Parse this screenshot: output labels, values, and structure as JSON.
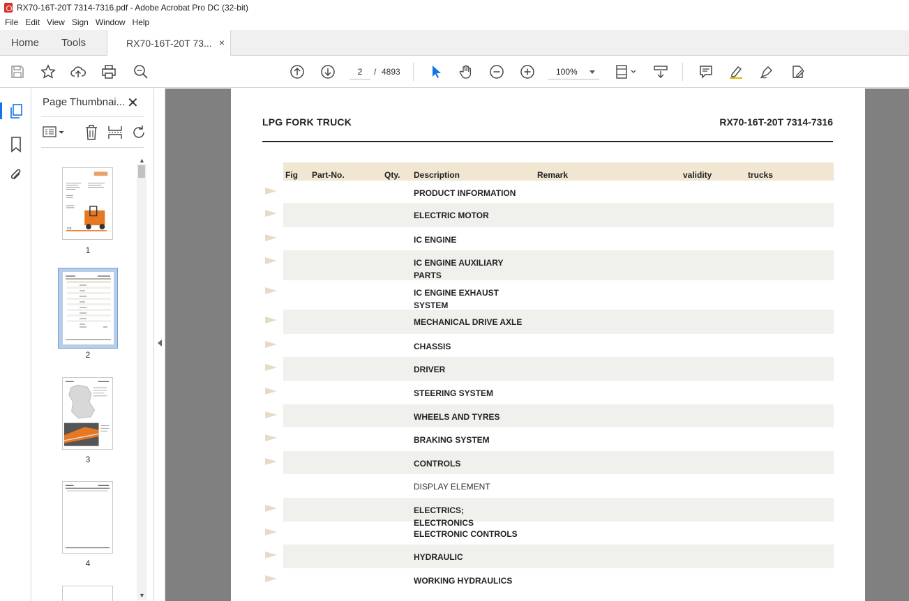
{
  "window": {
    "title": "RX70-16T-20T  7314-7316.pdf - Adobe Acrobat Pro DC (32-bit)"
  },
  "menu": [
    "File",
    "Edit",
    "View",
    "Sign",
    "Window",
    "Help"
  ],
  "tabs": {
    "home": "Home",
    "tools": "Tools",
    "doc": "RX70-16T-20T  73...",
    "close": "×"
  },
  "toolbar": {
    "page_current": "2",
    "page_sep": "/",
    "page_total": "4893",
    "zoom": "100%"
  },
  "panel": {
    "title": "Page Thumbnai...",
    "close": "✕",
    "thumbs": [
      "1",
      "2",
      "3",
      "4"
    ]
  },
  "document": {
    "header_left": "LPG FORK TRUCK",
    "header_right": "RX70-16T-20T 7314-7316",
    "columns": [
      "Fig",
      "Part-No.",
      "Qty.",
      "Description",
      "Remark",
      "validity",
      "trucks"
    ],
    "rows": [
      {
        "desc": "PRODUCT INFORMATION",
        "arrow": true
      },
      {
        "desc": "ELECTRIC MOTOR",
        "arrow": true
      },
      {
        "desc": "IC ENGINE",
        "arrow": true
      },
      {
        "desc": "IC ENGINE AUXILIARY PARTS",
        "arrow": true
      },
      {
        "desc": "IC ENGINE EXHAUST SYSTEM",
        "arrow": true
      },
      {
        "desc": "MECHANICAL DRIVE AXLE",
        "arrow": true
      },
      {
        "desc": "CHASSIS",
        "arrow": true
      },
      {
        "desc": "DRIVER",
        "arrow": true
      },
      {
        "desc": "STEERING SYSTEM",
        "arrow": true
      },
      {
        "desc": "WHEELS AND TYRES",
        "arrow": true
      },
      {
        "desc": "BRAKING SYSTEM",
        "arrow": true
      },
      {
        "desc": "CONTROLS",
        "arrow": true
      },
      {
        "desc": "DISPLAY ELEMENT",
        "arrow": false
      },
      {
        "desc": "ELECTRICS; ELECTRONICS",
        "arrow": true
      },
      {
        "desc": "ELECTRONIC CONTROLS",
        "arrow": true
      },
      {
        "desc": "HYDRAULIC",
        "arrow": true
      },
      {
        "desc": "WORKING HYDRAULICS",
        "arrow": true
      }
    ]
  },
  "colors": {
    "accent": "#1473e6",
    "header_band": "#f0e6d2",
    "row_shade": "#f0f0ec",
    "arrow": "#e6dcc6"
  }
}
